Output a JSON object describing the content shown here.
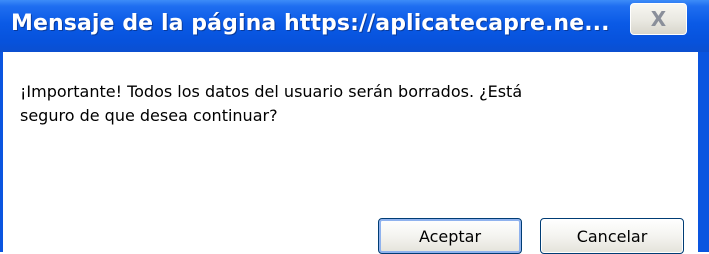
{
  "window": {
    "title": "Mensaje de la página https://aplicatecapre.ne...",
    "close_label": "X"
  },
  "dialog": {
    "message_line1": "¡Importante! Todos los datos del usuario serán borrados. ¿Está",
    "message_line2": "seguro de que desea continuar?"
  },
  "buttons": {
    "accept_label": "Aceptar",
    "cancel_label": "Cancelar"
  },
  "colors": {
    "titlebar": "#0a5ae6",
    "frame": "#0a55e0",
    "button_border": "#003c74"
  }
}
